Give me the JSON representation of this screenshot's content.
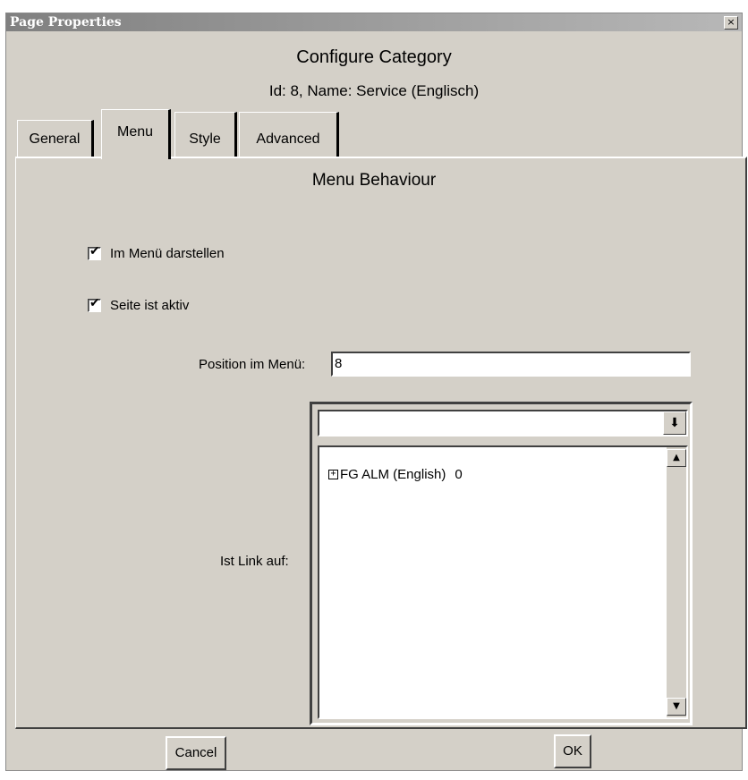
{
  "window": {
    "title": "Page Properties",
    "close_glyph": "×"
  },
  "header": {
    "title": "Configure Category",
    "subtitle": "Id: 8, Name: Service (Englisch)"
  },
  "tabs": [
    {
      "label": "General",
      "selected": false
    },
    {
      "label": "Menu",
      "selected": true
    },
    {
      "label": "Style",
      "selected": false
    },
    {
      "label": "Advanced",
      "selected": false
    }
  ],
  "menu": {
    "section_title": "Menu Behaviour",
    "show_in_menu": {
      "label": "Im Menü darstellen",
      "checked": true
    },
    "page_active": {
      "label": "Seite ist aktiv",
      "checked": true
    },
    "position": {
      "label": "Position im Menü:",
      "value": "8"
    },
    "link": {
      "label": "Ist Link auf:",
      "combo_value": "",
      "tree_items": [
        {
          "label": "FG ALM (English)",
          "count": "0",
          "expander": "+"
        }
      ]
    }
  },
  "buttons": {
    "cancel": "Cancel",
    "ok": "OK"
  },
  "icons": {
    "check": "✔",
    "arrow_down": "▼",
    "arrow_up": "▲",
    "combo_arrow": "⬇"
  },
  "colors": {
    "face": "#d4d0c8",
    "titlebar": "#808080"
  }
}
